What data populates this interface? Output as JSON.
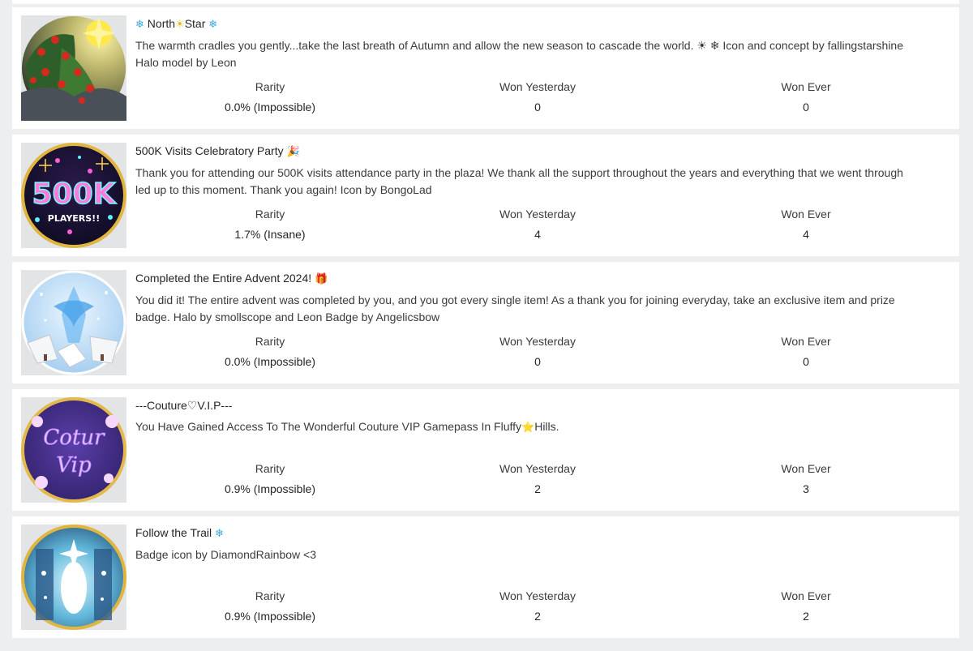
{
  "badges": [
    {
      "title_parts": [
        "❄",
        "North",
        "☀",
        "Star",
        "❄"
      ],
      "desc_lines": [
        "The warmth cradles you gently...take the last breath of Autumn and allow the new season to cascade the world. ☀ ❄  Icon and concept by fallingstarshine",
        "Halo model by Leon"
      ],
      "stats": {
        "rarity_label": "Rarity",
        "rarity": "0.0% (Impossible)",
        "yesterday_label": "Won Yesterday",
        "yesterday": "0",
        "ever_label": "Won Ever",
        "ever": "0"
      }
    },
    {
      "title": "500K Visits Celebratory Party",
      "title_emoji": "🎉",
      "desc_lines": [
        "Thank you for attending our 500K visits attendance party in the plaza! We thank all the support throughout the years and everything that we went through",
        "led up to this moment. Thank you again! Icon by BongoLad"
      ],
      "icon_text": {
        "big": "500K",
        "small": "PLAYERS!!"
      },
      "stats": {
        "rarity_label": "Rarity",
        "rarity": "1.7% (Insane)",
        "yesterday_label": "Won Yesterday",
        "yesterday": "4",
        "ever_label": "Won Ever",
        "ever": "4"
      }
    },
    {
      "title": "Completed the Entire Advent 2024!",
      "title_emoji": "🎁",
      "desc_lines": [
        "You did it! The entire advent was completed by you, and you got every single item! As a thank you for joining everyday, take an exclusive item and prize",
        "badge. Halo by smollscope and Leon Badge by Angelicsbow"
      ],
      "stats": {
        "rarity_label": "Rarity",
        "rarity": "0.0% (Impossible)",
        "yesterday_label": "Won Yesterday",
        "yesterday": "0",
        "ever_label": "Won Ever",
        "ever": "0"
      }
    },
    {
      "title": "---Couture♡V.I.P---",
      "desc_parts": [
        "You Have Gained Access To The Wonderful Couture VIP Gamepass In Fluffy",
        "⭐",
        "Hills."
      ],
      "icon_text": {
        "line1": "Cotur",
        "line2": "Vip"
      },
      "stats": {
        "rarity_label": "Rarity",
        "rarity": "0.9% (Impossible)",
        "yesterday_label": "Won Yesterday",
        "yesterday": "2",
        "ever_label": "Won Ever",
        "ever": "3"
      }
    },
    {
      "title": "Follow the Trail",
      "title_emoji": "❄",
      "desc": "Badge icon by DiamondRainbow <3",
      "stats": {
        "rarity_label": "Rarity",
        "rarity": "0.9% (Impossible)",
        "yesterday_label": "Won Yesterday",
        "yesterday": "2",
        "ever_label": "Won Ever",
        "ever": "2"
      }
    }
  ]
}
